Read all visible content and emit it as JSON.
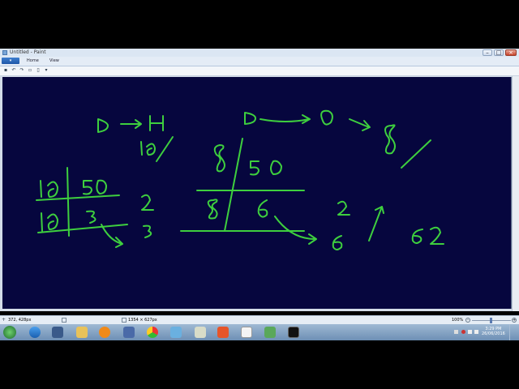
{
  "window": {
    "title": "Untitled - Paint"
  },
  "ribbon": {
    "tabs": [
      {
        "label": "Home"
      },
      {
        "label": "View"
      }
    ]
  },
  "status": {
    "cursor_pos": "372, 428px",
    "image_size": "1354 × 627px",
    "zoom": "100%"
  },
  "tray": {
    "time": "3:29 PM",
    "date": "26/06/2016"
  },
  "colors": {
    "canvas": "#06063e",
    "ink": "#3ecf3e",
    "titlebar": "#dbe6f3"
  }
}
